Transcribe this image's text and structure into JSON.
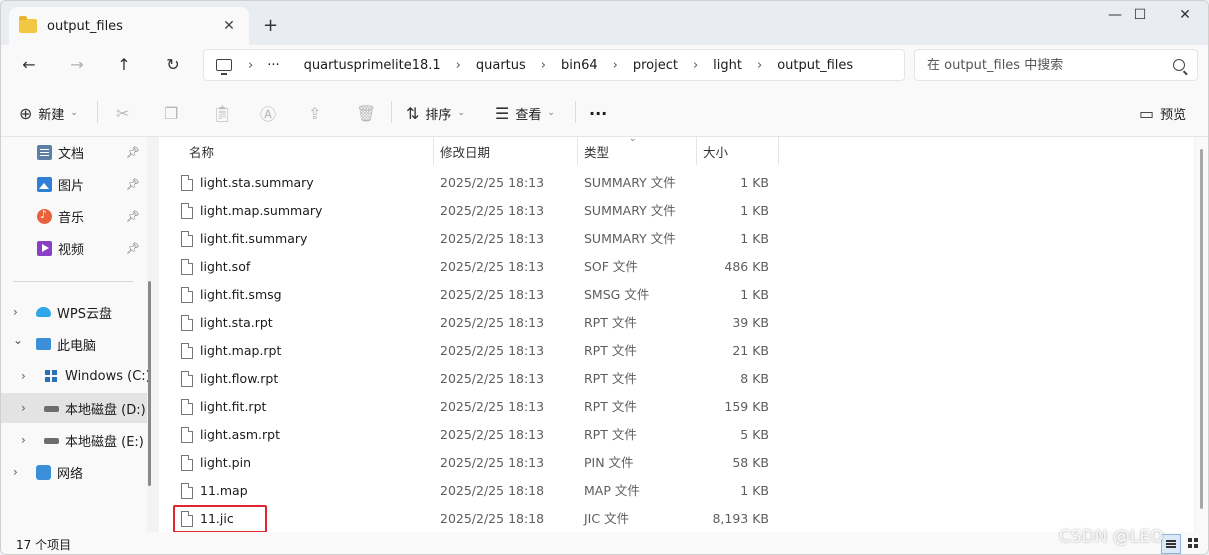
{
  "tab": {
    "title": "output_files"
  },
  "window_controls": {
    "minimize": "—",
    "maximize": "☐",
    "close": "✕"
  },
  "nav": {
    "back": "←",
    "forward": "→",
    "up": "↑",
    "refresh": "↻"
  },
  "breadcrumb": {
    "more": "···",
    "items": [
      "quartusprimelite18.1",
      "quartus",
      "bin64",
      "project",
      "light",
      "output_files"
    ]
  },
  "search": {
    "placeholder": "在 output_files 中搜索"
  },
  "toolbar": {
    "new_label": "新建",
    "sort_label": "排序",
    "view_label": "查看",
    "more_label": "···",
    "preview_label": "预览"
  },
  "sidebar": {
    "quick": [
      {
        "label": "文档",
        "icon": "documents-icon"
      },
      {
        "label": "图片",
        "icon": "pictures-icon"
      },
      {
        "label": "音乐",
        "icon": "music-icon"
      },
      {
        "label": "视频",
        "icon": "videos-icon"
      }
    ],
    "tree": [
      {
        "label": "WPS云盘",
        "icon": "wps-cloud-icon",
        "chevron": "›"
      },
      {
        "label": "此电脑",
        "icon": "this-pc-icon",
        "chevron": "⌄"
      },
      {
        "label": "Windows (C:)",
        "icon": "windows-drive-icon",
        "chevron": "›"
      },
      {
        "label": "本地磁盘 (D:)",
        "icon": "local-disk-icon",
        "chevron": "›",
        "selected": true
      },
      {
        "label": "本地磁盘 (E:)",
        "icon": "local-disk-icon",
        "chevron": "›"
      },
      {
        "label": "网络",
        "icon": "network-icon",
        "chevron": "›"
      }
    ]
  },
  "columns": {
    "name": "名称",
    "date": "修改日期",
    "type": "类型",
    "size": "大小"
  },
  "files": [
    {
      "name": "light.sta.summary",
      "date": "2025/2/25 18:13",
      "type": "SUMMARY 文件",
      "size": "1 KB"
    },
    {
      "name": "light.map.summary",
      "date": "2025/2/25 18:13",
      "type": "SUMMARY 文件",
      "size": "1 KB"
    },
    {
      "name": "light.fit.summary",
      "date": "2025/2/25 18:13",
      "type": "SUMMARY 文件",
      "size": "1 KB"
    },
    {
      "name": "light.sof",
      "date": "2025/2/25 18:13",
      "type": "SOF 文件",
      "size": "486 KB"
    },
    {
      "name": "light.fit.smsg",
      "date": "2025/2/25 18:13",
      "type": "SMSG 文件",
      "size": "1 KB"
    },
    {
      "name": "light.sta.rpt",
      "date": "2025/2/25 18:13",
      "type": "RPT 文件",
      "size": "39 KB"
    },
    {
      "name": "light.map.rpt",
      "date": "2025/2/25 18:13",
      "type": "RPT 文件",
      "size": "21 KB"
    },
    {
      "name": "light.flow.rpt",
      "date": "2025/2/25 18:13",
      "type": "RPT 文件",
      "size": "8 KB"
    },
    {
      "name": "light.fit.rpt",
      "date": "2025/2/25 18:13",
      "type": "RPT 文件",
      "size": "159 KB"
    },
    {
      "name": "light.asm.rpt",
      "date": "2025/2/25 18:13",
      "type": "RPT 文件",
      "size": "5 KB"
    },
    {
      "name": "light.pin",
      "date": "2025/2/25 18:13",
      "type": "PIN 文件",
      "size": "58 KB"
    },
    {
      "name": "11.map",
      "date": "2025/2/25 18:18",
      "type": "MAP 文件",
      "size": "1 KB"
    },
    {
      "name": "11.jic",
      "date": "2025/2/25 18:18",
      "type": "JIC 文件",
      "size": "8,193 KB"
    }
  ],
  "highlight_color": "#e0262d",
  "status": {
    "count": "17 个项目"
  },
  "watermark": "CSDN @LEO"
}
